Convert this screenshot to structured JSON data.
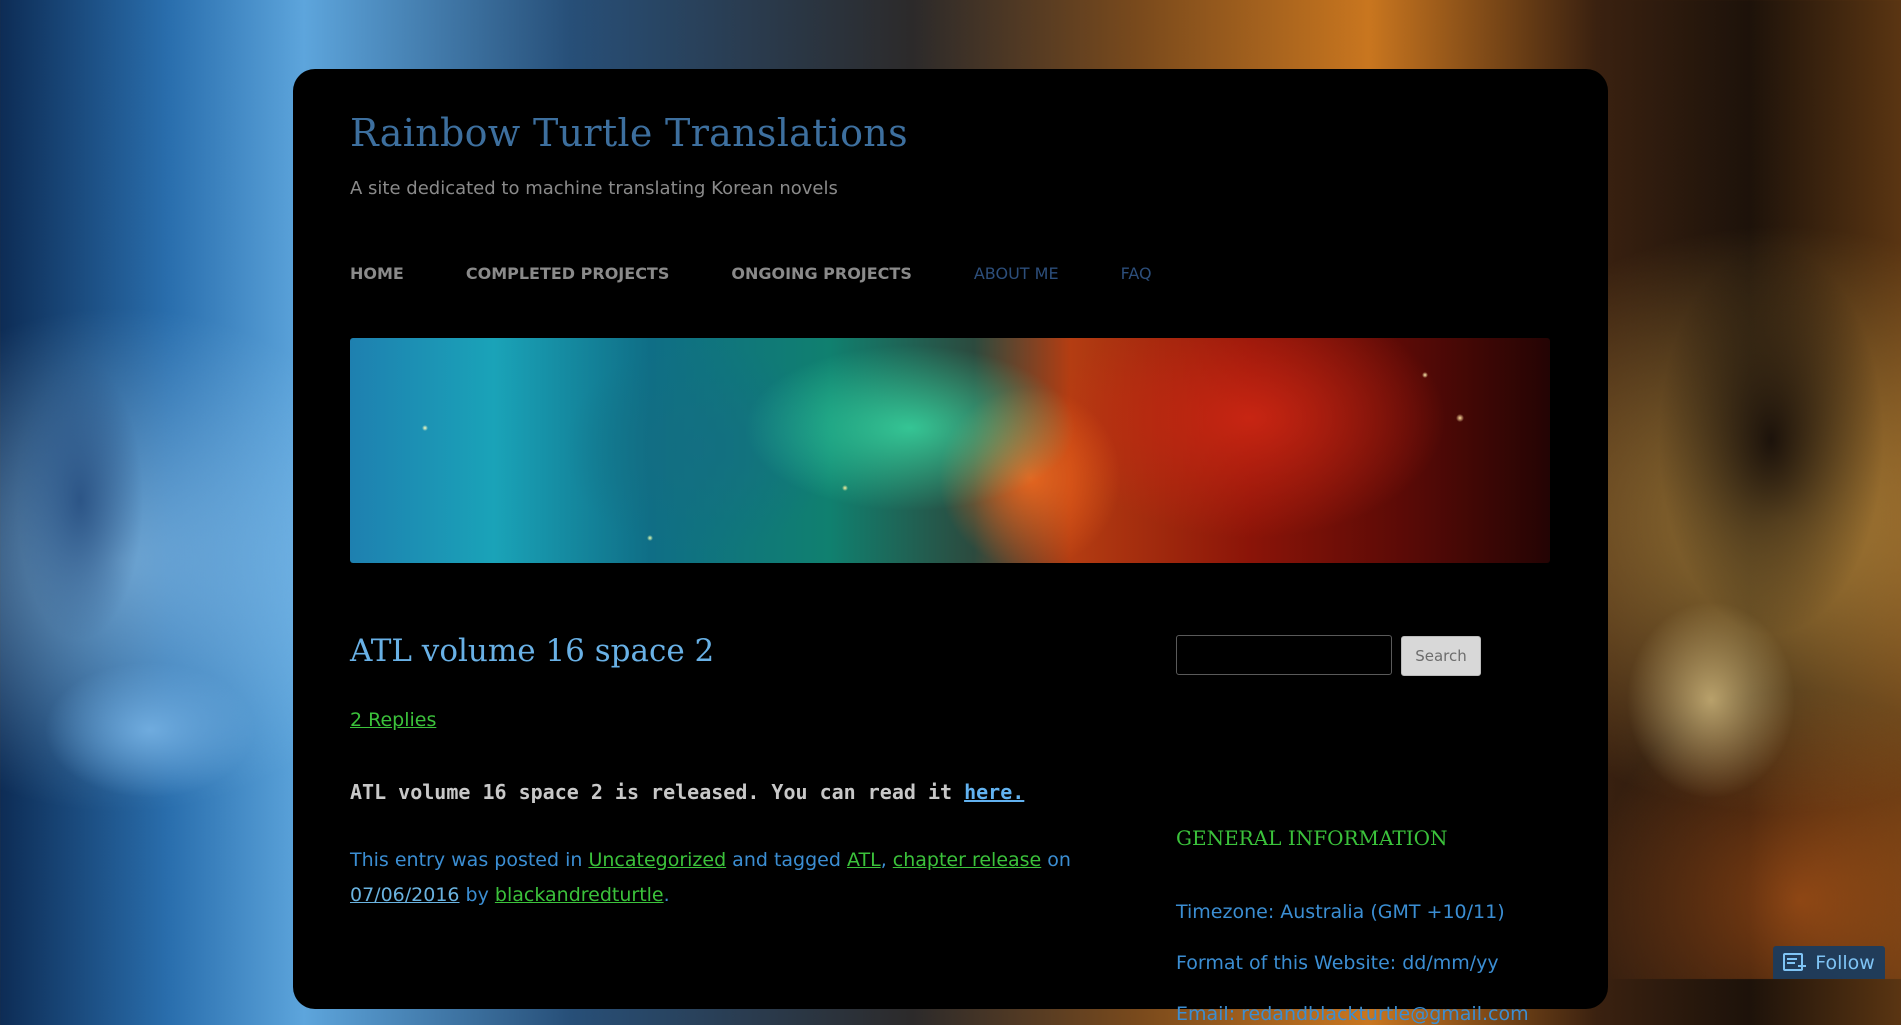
{
  "site": {
    "title": "Rainbow Turtle Translations",
    "description": "A site dedicated to machine translating Korean novels"
  },
  "nav": [
    {
      "label": "HOME"
    },
    {
      "label": "COMPLETED PROJECTS"
    },
    {
      "label": "ONGOING PROJECTS"
    },
    {
      "label": "ABOUT ME"
    },
    {
      "label": "FAQ"
    }
  ],
  "post": {
    "title": "ATL volume 16 space 2",
    "replies": "2 Replies",
    "content_text": "ATL volume 16 space 2 is released. You can read it ",
    "content_link": "here.",
    "meta": {
      "prefix": "This entry was posted in ",
      "category": "Uncategorized",
      "tagged": " and tagged ",
      "tag1": "ATL",
      "comma": ", ",
      "tag2": "chapter release",
      "on": " on ",
      "date": "07/06/2016",
      "by": " by ",
      "author": "blackandredturtle",
      "end": "."
    }
  },
  "sidebar": {
    "search": {
      "value": "",
      "button_label": "Search"
    },
    "widget_title": "GENERAL INFORMATION",
    "info_lines": [
      "Timezone: Australia (GMT +10/11)",
      "Format of this Website: dd/mm/yy",
      "Email: redandblackturtle@gmail.com"
    ]
  },
  "follow": {
    "label": "Follow"
  },
  "colors": {
    "nav_active": "#8a8a8a",
    "nav_muted": "#2c4e7b",
    "link_green": "#3bc23b",
    "text_blue": "#3b8ed3",
    "title_blue": "#3d6f9e"
  }
}
